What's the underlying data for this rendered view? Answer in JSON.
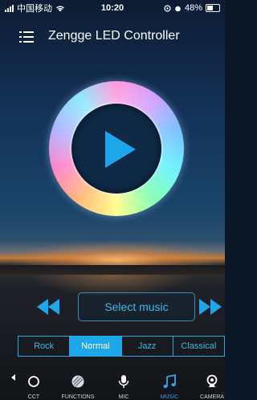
{
  "status_bar": {
    "carrier": "中国移动",
    "time": "10:20",
    "battery": "48%",
    "icons": [
      "signal-icon",
      "wifi-icon",
      "location-icon",
      "alarm-icon",
      "battery-icon"
    ]
  },
  "header": {
    "title": "Zengge LED Controller",
    "menu_icon": "menu-icon"
  },
  "player": {
    "disc_icon": "disc-icon",
    "play_icon": "play-icon",
    "prev_icon": "rewind-icon",
    "next_icon": "fast-forward-icon",
    "select_music_label": "Select music"
  },
  "genres": {
    "items": [
      "Rock",
      "Normal",
      "Jazz",
      "Classical"
    ],
    "selected": "Normal"
  },
  "tabbar": {
    "items": [
      {
        "label": "CCT",
        "icon": "cct-icon"
      },
      {
        "label": "FUNCTIONS",
        "icon": "functions-icon"
      },
      {
        "label": "MIC",
        "icon": "microphone-icon"
      },
      {
        "label": "MUSIC",
        "icon": "music-note-icon"
      },
      {
        "label": "CAMERA",
        "icon": "camera-icon"
      }
    ],
    "active": "MUSIC"
  },
  "colors": {
    "accent": "#1da6ea",
    "accent_text": "#3fb8ea",
    "play": "#1da6ea"
  }
}
